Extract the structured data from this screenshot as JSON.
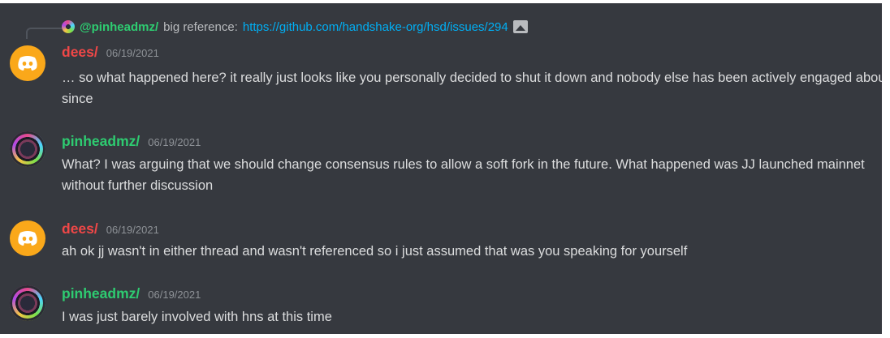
{
  "reply": {
    "user": "@pinheadmz/",
    "text": "big reference:",
    "link": "https://github.com/handshake-org/hsd/issues/294"
  },
  "messages": [
    {
      "user": "dees/",
      "timestamp": "06/19/2021",
      "content": "… so what happened here? it really just looks like you personally decided to shut it down and nobody else has been actively engaged about it since"
    },
    {
      "user": "pinheadmz/",
      "timestamp": "06/19/2021",
      "content": "What? I was arguing that we should change consensus rules to allow a soft fork in the future.  What happened was JJ launched mainnet without further discussion"
    },
    {
      "user": "dees/",
      "timestamp": "06/19/2021",
      "content": "ah ok jj wasn't in either thread and wasn't referenced so i just assumed that was you speaking for yourself"
    },
    {
      "user": "pinheadmz/",
      "timestamp": "06/19/2021",
      "content": "I was just barely involved with hns at this time"
    }
  ],
  "colors": {
    "background": "#36393f",
    "dees_name": "#f04747",
    "pinheadmz_name": "#2ecc71",
    "link": "#00aff4",
    "discord_avatar": "#faa81a"
  }
}
